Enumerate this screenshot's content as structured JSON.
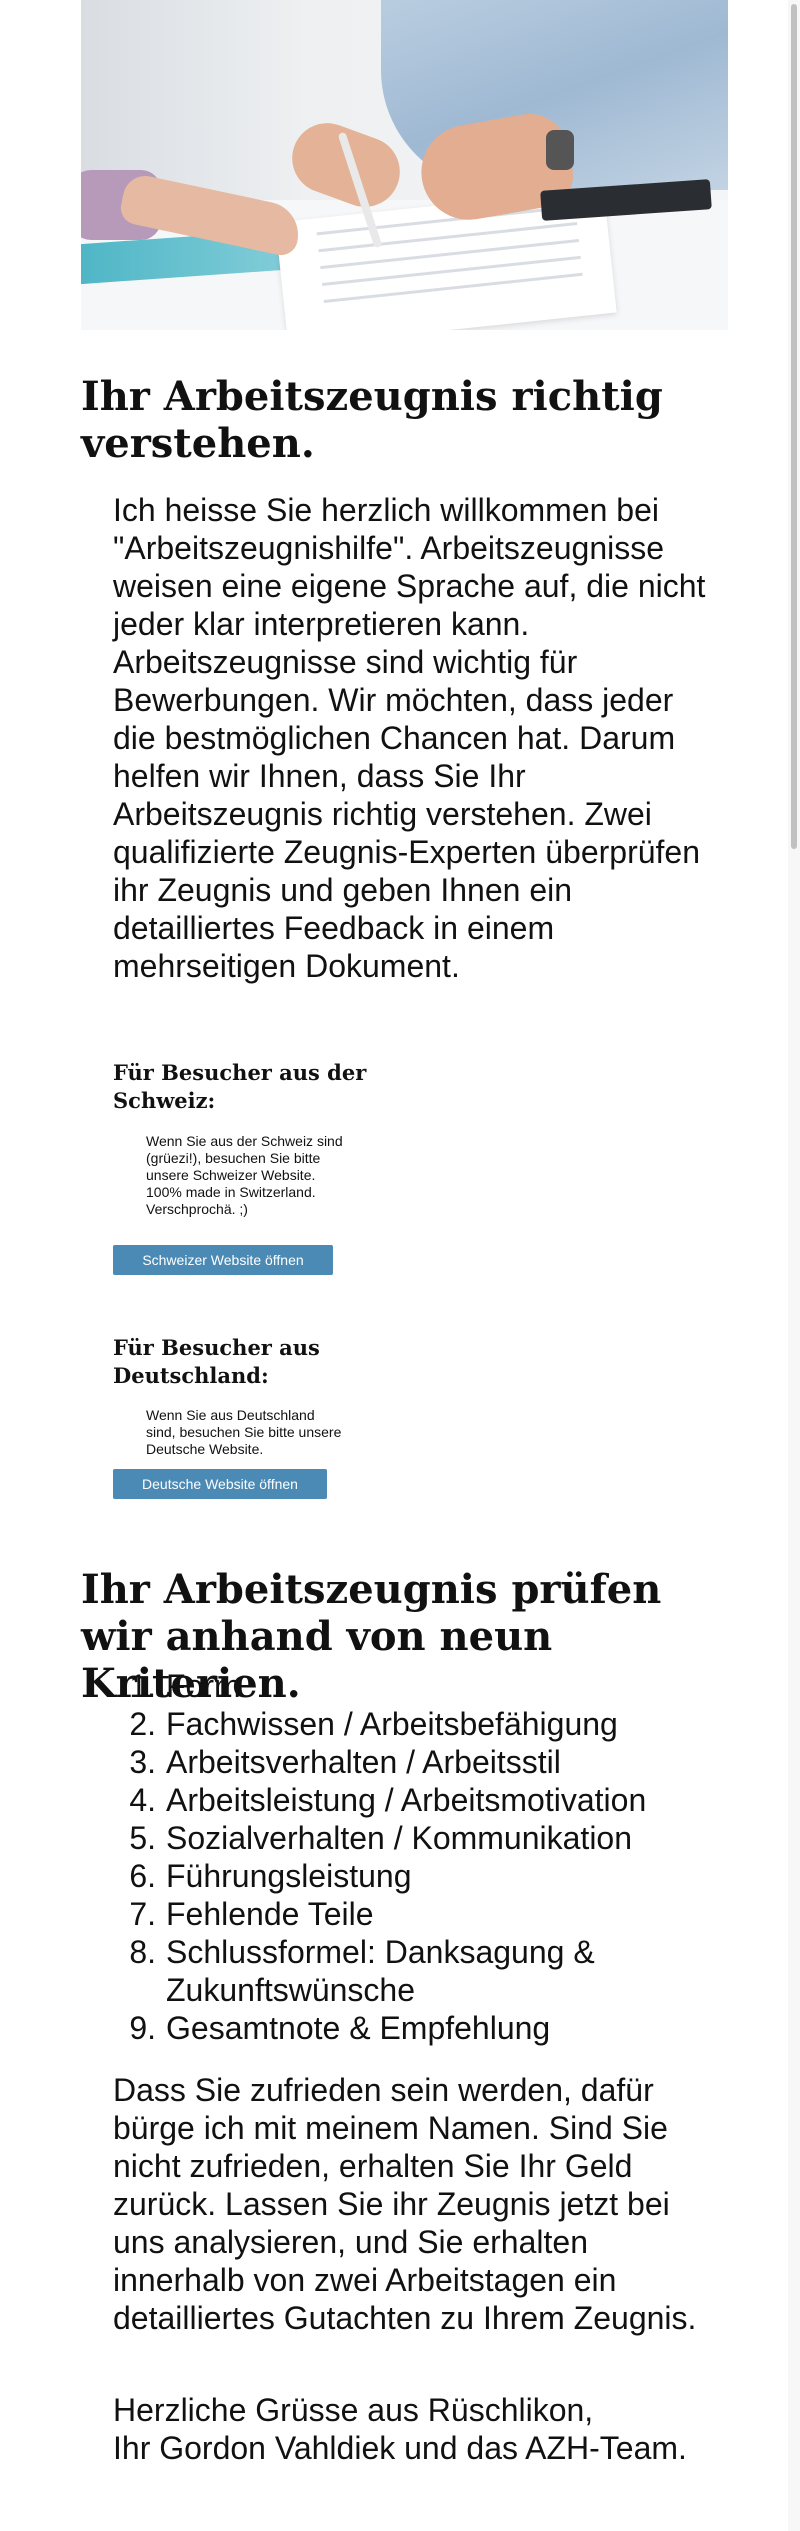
{
  "hero": {
    "image": "office-desk-document-review-photo"
  },
  "intro": {
    "title": "Ihr Arbeitszeugnis richtig verstehen.",
    "text": "Ich heisse Sie herzlich willkommen bei \"Arbeitszeugnishilfe\". Arbeitszeugnisse weisen eine eigene Sprache auf, die nicht jeder klar interpretieren kann. Arbeitszeugnisse sind wichtig für Bewerbungen. Wir möchten, dass jeder die bestmöglichen Chancen hat. Darum helfen wir Ihnen, dass Sie Ihr Arbeitszeugnis richtig verstehen. Zwei qualifizierte Zeugnis-Experten überprüfen ihr Zeugnis und geben Ihnen ein detailliertes Feedback in einem mehrseitigen Dokument."
  },
  "switzerland": {
    "heading": "Für Besucher aus der Schweiz:",
    "text": "Wenn Sie aus der Schweiz sind (grüezi!), besuchen Sie bitte unsere Schweizer Website. 100% made in Switzerland. Verschprochä. ;)",
    "button": "Schweizer Website öffnen"
  },
  "germany": {
    "heading": "Für Besucher aus Deutschland:",
    "text": "Wenn Sie aus Deutschland sind, besuchen Sie bitte unsere Deutsche Website.",
    "button": "Deutsche Website öffnen"
  },
  "criteria": {
    "title": "Ihr Arbeitszeugnis prüfen wir anhand von neun Kriterien.",
    "items": [
      {
        "num": "1.",
        "label": "Form"
      },
      {
        "num": "2.",
        "label": "Fachwissen / Arbeitsbefähigung"
      },
      {
        "num": "3.",
        "label": "Arbeitsverhalten / Arbeitsstil"
      },
      {
        "num": "4.",
        "label": "Arbeitsleistung / Arbeitsmotivation"
      },
      {
        "num": "5.",
        "label": "Sozialverhalten / Kommunikation"
      },
      {
        "num": "6.",
        "label": "Führungsleistung"
      },
      {
        "num": "7.",
        "label": "Fehlende Teile"
      },
      {
        "num": "8.",
        "label": "Schlussformel: Danksagung & Zukunftswünsche"
      },
      {
        "num": "9.",
        "label": "Gesamtnote & Empfehlung"
      }
    ]
  },
  "guarantee": {
    "text": "Dass Sie zufrieden sein werden, dafür bürge ich mit meinem Namen. Sind Sie nicht zufrieden, erhalten Sie Ihr Geld zurück. Lassen Sie ihr Zeugnis jetzt bei uns analysieren, und Sie erhalten innerhalb von zwei Arbeitstagen ein detailliertes Gutachten zu Ihrem Zeugnis."
  },
  "signature": {
    "line1": "Herzliche Grüsse aus Rüschlikon,",
    "line2": "Ihr Gordon Vahldiek und das AZH-Team."
  }
}
